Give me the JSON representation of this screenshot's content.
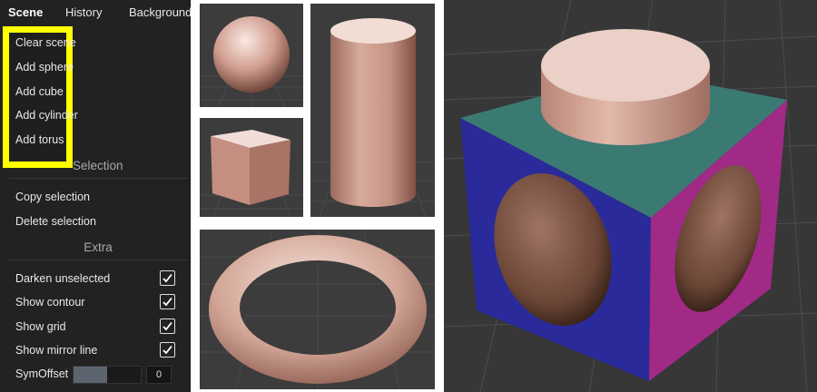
{
  "tabs": [
    {
      "label": "Scene",
      "active": true
    },
    {
      "label": "History",
      "active": false
    },
    {
      "label": "Background",
      "active": false
    }
  ],
  "scene_menu": {
    "items": [
      "Clear scene",
      "Add sphere",
      "Add cube",
      "Add cylinder",
      "Add torus"
    ],
    "highlight_color": "#ffff00"
  },
  "selection": {
    "title": "Selection",
    "items": [
      "Copy selection",
      "Delete selection"
    ]
  },
  "extra": {
    "title": "Extra",
    "options": [
      {
        "label": "Darken unselected",
        "checked": true
      },
      {
        "label": "Show contour",
        "checked": true
      },
      {
        "label": "Show grid",
        "checked": true
      },
      {
        "label": "Show mirror line",
        "checked": true
      }
    ],
    "sym_offset": {
      "label": "SymOffset",
      "value": "0",
      "fill_fraction": 0.5
    }
  },
  "icons": {
    "checkbox": "checkmark-icon"
  },
  "colors": {
    "panel_bg": "#222222",
    "viewport_bg": "#373737",
    "clay": "#d2a596",
    "cube_top": "#3b7a72",
    "cube_front": "#2a2a9a",
    "cube_side": "#a02a86"
  }
}
